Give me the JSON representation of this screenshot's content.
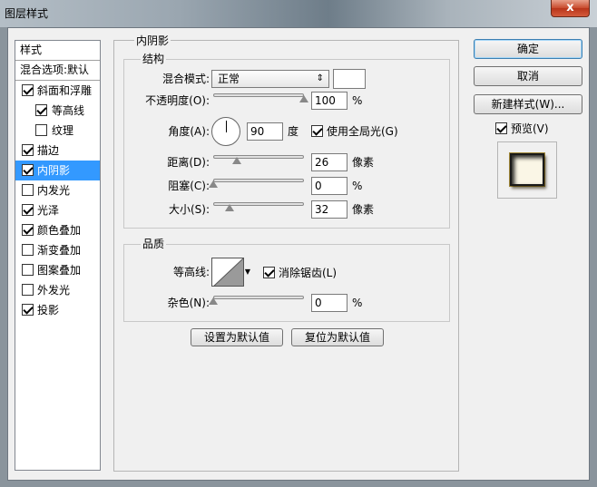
{
  "window": {
    "title": "图层样式",
    "close_symbol": "x"
  },
  "styles_list": {
    "header": "样式",
    "blending_options": "混合选项:默认",
    "items": [
      {
        "label": "斜面和浮雕",
        "checked": true,
        "sub": false,
        "selected": false
      },
      {
        "label": "等高线",
        "checked": true,
        "sub": true,
        "selected": false
      },
      {
        "label": "纹理",
        "checked": false,
        "sub": true,
        "selected": false
      },
      {
        "label": "描边",
        "checked": true,
        "sub": false,
        "selected": false
      },
      {
        "label": "内阴影",
        "checked": true,
        "sub": false,
        "selected": true
      },
      {
        "label": "内发光",
        "checked": false,
        "sub": false,
        "selected": false
      },
      {
        "label": "光泽",
        "checked": true,
        "sub": false,
        "selected": false
      },
      {
        "label": "颜色叠加",
        "checked": true,
        "sub": false,
        "selected": false
      },
      {
        "label": "渐变叠加",
        "checked": false,
        "sub": false,
        "selected": false
      },
      {
        "label": "图案叠加",
        "checked": false,
        "sub": false,
        "selected": false
      },
      {
        "label": "外发光",
        "checked": false,
        "sub": false,
        "selected": false
      },
      {
        "label": "投影",
        "checked": true,
        "sub": false,
        "selected": false
      }
    ]
  },
  "inner_shadow": {
    "title": "内阴影",
    "structure": {
      "title": "结构",
      "blend_mode_label": "混合模式:",
      "blend_mode_value": "正常",
      "blend_color": "#ffffff",
      "opacity_label": "不透明度(O):",
      "opacity_value": "100",
      "opacity_unit": "%",
      "angle_label": "角度(A):",
      "angle_value": "90",
      "angle_unit": "度",
      "global_light_label": "使用全局光(G)",
      "global_light_checked": true,
      "distance_label": "距离(D):",
      "distance_value": "26",
      "distance_unit": "像素",
      "choke_label": "阻塞(C):",
      "choke_value": "0",
      "choke_unit": "%",
      "size_label": "大小(S):",
      "size_value": "32",
      "size_unit": "像素"
    },
    "quality": {
      "title": "品质",
      "contour_label": "等高线:",
      "antialias_label": "消除锯齿(L)",
      "antialias_checked": true,
      "noise_label": "杂色(N):",
      "noise_value": "0",
      "noise_unit": "%"
    },
    "make_default": "设置为默认值",
    "reset_default": "复位为默认值"
  },
  "buttons": {
    "ok": "确定",
    "cancel": "取消",
    "new_style": "新建样式(W)...",
    "preview_label": "预览(V)",
    "preview_checked": true
  },
  "slider_levels": {
    "opacity": 1.0,
    "distance": 0.26,
    "choke": 0.0,
    "size": 0.18,
    "noise": 0.0
  }
}
